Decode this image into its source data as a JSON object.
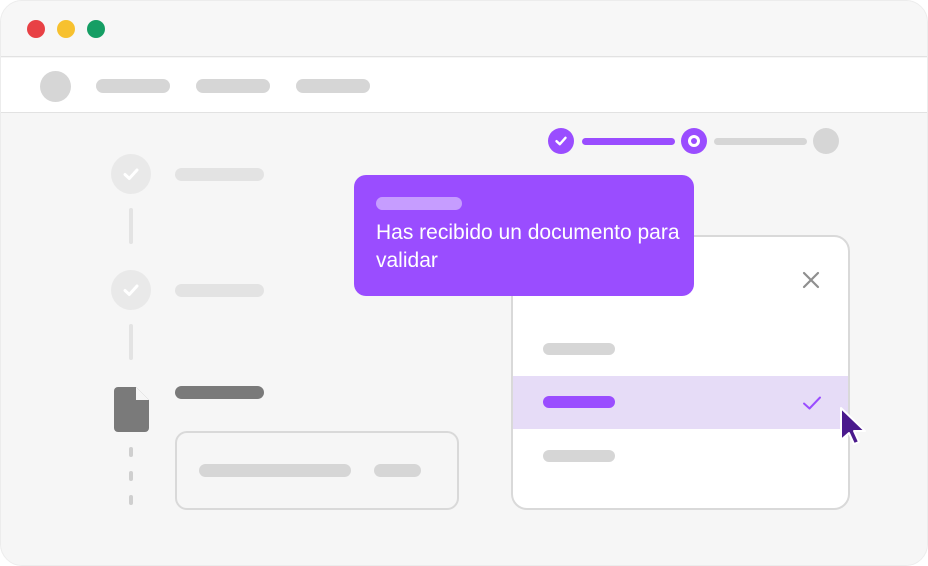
{
  "window": {
    "controls": [
      "close",
      "minimize",
      "maximize"
    ],
    "colors": {
      "close": "#e84145",
      "minimize": "#f7c12f",
      "maximize": "#159e64"
    }
  },
  "navbar": {
    "avatar": "avatar",
    "items": [
      "",
      "",
      ""
    ]
  },
  "stepper": {
    "steps": [
      "completed",
      "current",
      "pending"
    ],
    "accent": "#9a4dff"
  },
  "timeline": {
    "items": [
      {
        "state": "completed",
        "icon": "check-icon"
      },
      {
        "state": "completed",
        "icon": "check-icon"
      },
      {
        "state": "current",
        "icon": "document-icon"
      }
    ]
  },
  "tooltip": {
    "text": "Has recibido un documento para validar",
    "background": "#9a4dff"
  },
  "dropdown": {
    "close_icon": "close-icon",
    "options": [
      {
        "selected": false
      },
      {
        "selected": true,
        "icon": "check-icon"
      },
      {
        "selected": false
      }
    ],
    "selected_color": "#e6dcf7"
  },
  "cursor": {
    "icon": "cursor-arrow-icon",
    "color": "#4a1a8c"
  }
}
